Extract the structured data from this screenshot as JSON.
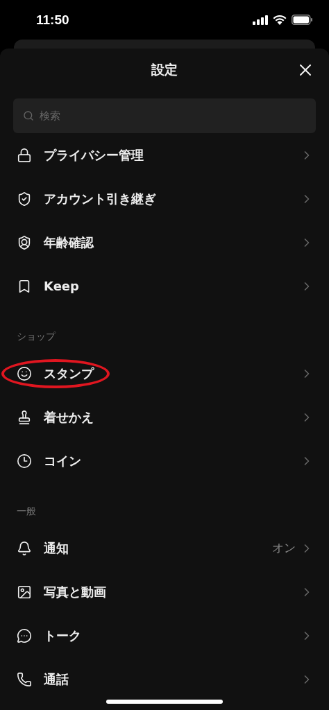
{
  "status_bar": {
    "time": "11:50"
  },
  "header": {
    "title": "設定"
  },
  "search": {
    "placeholder": "検索"
  },
  "sections": [
    {
      "items": [
        {
          "label": "プライバシー管理",
          "circled": false
        },
        {
          "label": "アカウント引き継ぎ",
          "circled": false
        },
        {
          "label": "年齢確認",
          "circled": false
        },
        {
          "label": "Keep",
          "circled": false
        }
      ]
    },
    {
      "title": "ショップ",
      "items": [
        {
          "label": "スタンプ",
          "circled": true
        },
        {
          "label": "着せかえ",
          "circled": false
        },
        {
          "label": "コイン",
          "circled": false
        }
      ]
    },
    {
      "title": "一般",
      "items": [
        {
          "label": "通知",
          "value": "オン",
          "circled": false
        },
        {
          "label": "写真と動画",
          "circled": false
        },
        {
          "label": "トーク",
          "circled": false
        },
        {
          "label": "通話",
          "circled": false
        }
      ]
    }
  ]
}
